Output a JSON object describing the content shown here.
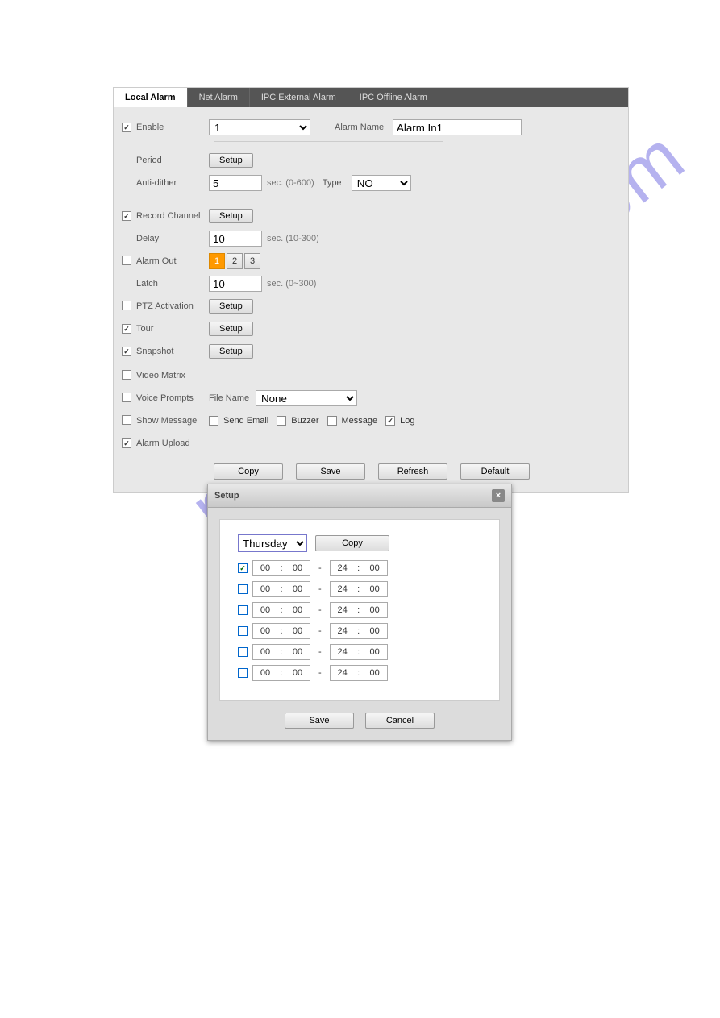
{
  "watermark": "manualshive.com",
  "tabs": {
    "t0": "Local Alarm",
    "t1": "Net Alarm",
    "t2": "IPC External Alarm",
    "t3": "IPC Offline Alarm"
  },
  "main": {
    "enable_lbl": "Enable",
    "enable_sel": "1",
    "alarmname_lbl": "Alarm Name",
    "alarmname_val": "Alarm In1",
    "period_lbl": "Period",
    "period_btn": "Setup",
    "anti_lbl": "Anti-dither",
    "anti_val": "5",
    "anti_hint": "sec. (0-600)",
    "type_lbl": "Type",
    "type_sel": "NO",
    "recch_lbl": "Record Channel",
    "recch_btn": "Setup",
    "delay_lbl": "Delay",
    "delay_val": "10",
    "delay_hint": "sec. (10-300)",
    "almout_lbl": "Alarm Out",
    "ao1": "1",
    "ao2": "2",
    "ao3": "3",
    "latch_lbl": "Latch",
    "latch_val": "10",
    "latch_hint": "sec. (0~300)",
    "ptz_lbl": "PTZ Activation",
    "ptz_btn": "Setup",
    "tour_lbl": "Tour",
    "tour_btn": "Setup",
    "snap_lbl": "Snapshot",
    "snap_btn": "Setup",
    "vmtx_lbl": "Video Matrix",
    "voice_lbl": "Voice Prompts",
    "fname_lbl": "File Name",
    "fname_sel": "None",
    "showmsg_lbl": "Show Message",
    "sendemail_lbl": "Send Email",
    "buzzer_lbl": "Buzzer",
    "message_lbl": "Message",
    "log_lbl": "Log",
    "upload_lbl": "Alarm Upload",
    "copy_btn": "Copy",
    "save_btn": "Save",
    "refresh_btn": "Refresh",
    "default_btn": "Default"
  },
  "modal": {
    "title": "Setup",
    "day": "Thursday",
    "copy_btn": "Copy",
    "rows": [
      {
        "c": true,
        "a1": "00",
        "a2": "00",
        "b1": "24",
        "b2": "00"
      },
      {
        "c": false,
        "a1": "00",
        "a2": "00",
        "b1": "24",
        "b2": "00"
      },
      {
        "c": false,
        "a1": "00",
        "a2": "00",
        "b1": "24",
        "b2": "00"
      },
      {
        "c": false,
        "a1": "00",
        "a2": "00",
        "b1": "24",
        "b2": "00"
      },
      {
        "c": false,
        "a1": "00",
        "a2": "00",
        "b1": "24",
        "b2": "00"
      },
      {
        "c": false,
        "a1": "00",
        "a2": "00",
        "b1": "24",
        "b2": "00"
      }
    ],
    "save_btn": "Save",
    "cancel_btn": "Cancel"
  }
}
